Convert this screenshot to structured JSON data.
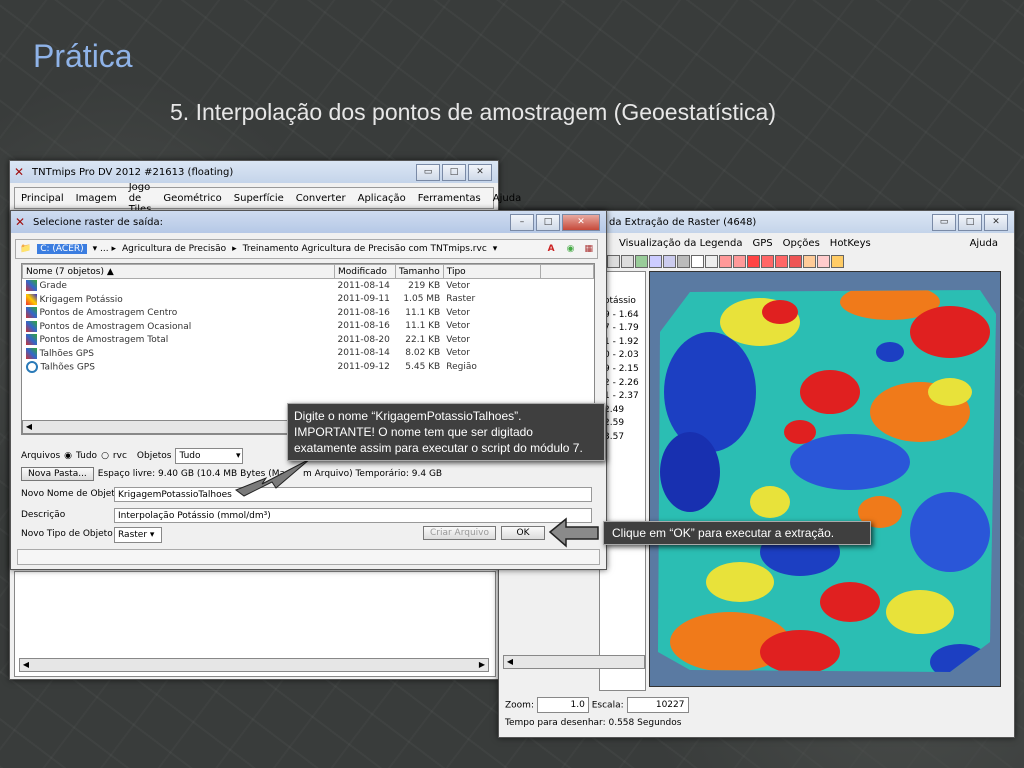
{
  "slide": {
    "title": "Prática",
    "subtitle": "5. Interpolação dos pontos de amostragem (Geoestatística)"
  },
  "main_window": {
    "title": "TNTmips Pro DV 2012  #21613 (floating)",
    "menu": [
      "Principal",
      "Imagem",
      "Jogo de Tiles",
      "Geométrico",
      "Superfície",
      "Converter",
      "Aplicação",
      "Ferramentas",
      "Ajuda"
    ]
  },
  "raster_window": {
    "title": "da Extração de Raster (4648)",
    "menu": [
      "Visualização da Legenda",
      "GPS",
      "Opções",
      "HotKeys"
    ],
    "help": "Ajuda",
    "legend_header": "otássio",
    "legend": [
      "9 - 1.64",
      "7 - 1.79",
      "1 - 1.92",
      "0 - 2.03",
      "9 - 2.15",
      "2 - 2.26",
      "1 - 2.37",
      "2.49",
      "2.59",
      "3.57"
    ],
    "zoom_label": "Zoom:",
    "zoom_value": "1.0",
    "scale_label": "Escala:",
    "scale_value": "10227",
    "draw_time": "Tempo para desenhar: 0.558 Segundos"
  },
  "select_dialog": {
    "title": "Selecione raster de saída:",
    "path": {
      "drive": "C: (ACER)",
      "crumbs": [
        "▾ ... ▸",
        "Agricultura de Precisão",
        "▸",
        "Treinamento Agricultura de Precisão com TNTmips.rvc",
        "▾"
      ]
    },
    "columns": [
      "Nome  (7 objetos) ▲",
      "Modificado",
      "Tamanho",
      "Tipo"
    ],
    "files": [
      {
        "name": "Grade",
        "date": "2011-08-14",
        "size": "219 KB",
        "type": "Vetor",
        "icon": "vector-icon"
      },
      {
        "name": "Krigagem Potássio",
        "date": "2011-09-11",
        "size": "1.05 MB",
        "type": "Raster",
        "icon": "raster-icon"
      },
      {
        "name": "Pontos de Amostragem Centro",
        "date": "2011-08-16",
        "size": "11.1 KB",
        "type": "Vetor",
        "icon": "vector-icon"
      },
      {
        "name": "Pontos de Amostragem Ocasional",
        "date": "2011-08-16",
        "size": "11.1 KB",
        "type": "Vetor",
        "icon": "vector-icon"
      },
      {
        "name": "Pontos de Amostragem Total",
        "date": "2011-08-20",
        "size": "22.1 KB",
        "type": "Vetor",
        "icon": "vector-icon"
      },
      {
        "name": "Talhões GPS",
        "date": "2011-08-14",
        "size": "8.02 KB",
        "type": "Vetor",
        "icon": "vector-icon"
      },
      {
        "name": "Talhões GPS",
        "date": "2011-09-12",
        "size": "5.45 KB",
        "type": "Região",
        "icon": "region-icon"
      }
    ],
    "arquivos_label": "Arquivos",
    "radio_tudo": "Tudo",
    "radio_rvc": "rvc",
    "objetos_label": "Objetos",
    "objetos_value": "Tudo",
    "new_folder": "Nova Pasta...",
    "free_space": "Espaço livre: 9.40 GB  (10.4 MB Bytes (Ma",
    "free_space_tail": "m Arquivo)   Temporário: 9.4 GB",
    "new_name_label": "Novo Nome de Objeto",
    "new_name_value": "KrigagemPotassioTalhoes",
    "desc_label": "Descrição",
    "desc_value": "Interpolação Potássio (mmol/dm³)",
    "type_label": "Novo Tipo de Objeto",
    "type_value": "Raster",
    "create_file": "Criar Arquivo",
    "ok": "OK"
  },
  "callouts": {
    "name_hint": "Digite o nome “KrigagemPotassioTalhoes”. IMPORTANTE! O nome tem que ser digitado exatamente assim para executar o script  do módulo 7.",
    "ok_hint": "Clique em “OK” para executar a extração."
  }
}
